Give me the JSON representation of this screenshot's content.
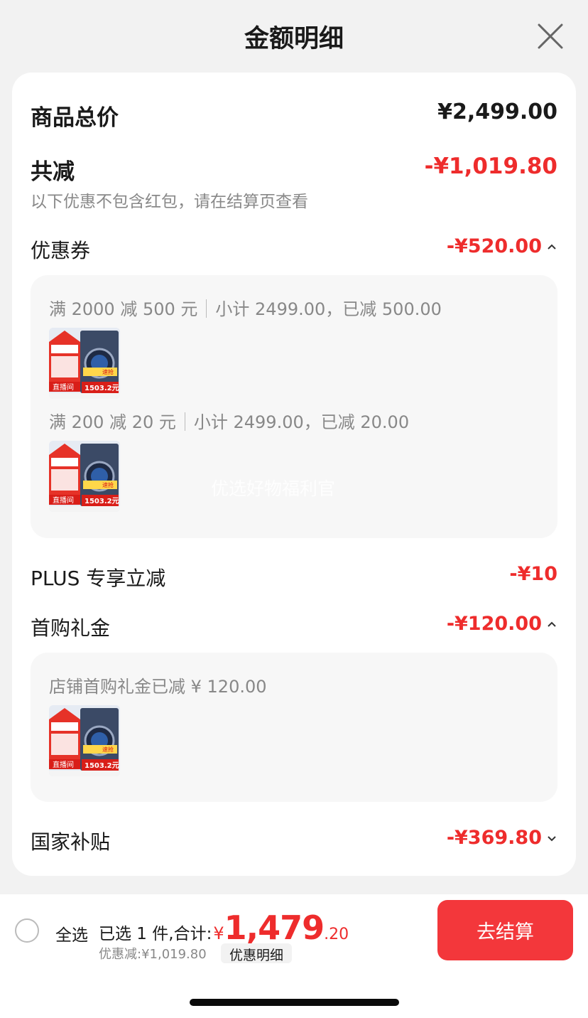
{
  "header": {
    "title": "金额明细"
  },
  "summary": {
    "total_label": "商品总价",
    "total_value": "¥2,499.00",
    "reduce_label": "共减",
    "reduce_value": "-¥1,019.80",
    "hint": "以下优惠不包含红包，请在结算页查看"
  },
  "coupon": {
    "label": "优惠券",
    "value": "-¥520.00",
    "items": [
      {
        "rule": "满 2000 减 500 元",
        "detail": "小计 2499.00，已减 500.00"
      },
      {
        "rule": "满 200 减 20 元",
        "detail": "小计 2499.00，已减 20.00"
      }
    ]
  },
  "watermark": "优选好物福利官",
  "product_thumb": {
    "badge_live": "直播间",
    "badge_rush": "速抢",
    "price_tag": "1503.2元"
  },
  "plus": {
    "label": "PLUS 专享立减",
    "value": "-¥10"
  },
  "first_gift": {
    "label": "首购礼金",
    "value": "-¥120.00",
    "detail": "店铺首购礼金已减 ¥ 120.00"
  },
  "subsidy": {
    "label": "国家补贴",
    "value": "-¥369.80"
  },
  "footer": {
    "select_all": "全选",
    "selected_prefix": "已选 1 件,合计:",
    "yen": "¥",
    "total_int": "1,479",
    "total_dec": ".20",
    "discount_line": "优惠减:¥1,019.80",
    "discount_detail": "优惠明细",
    "checkout": "去结算"
  },
  "colors": {
    "accent_red": "#ee2c2c",
    "checkout_bg": "#f3373b"
  },
  "icons": {
    "close": "close-icon",
    "chevron_up": "chevron-up-icon",
    "chevron_down": "chevron-down-icon"
  }
}
